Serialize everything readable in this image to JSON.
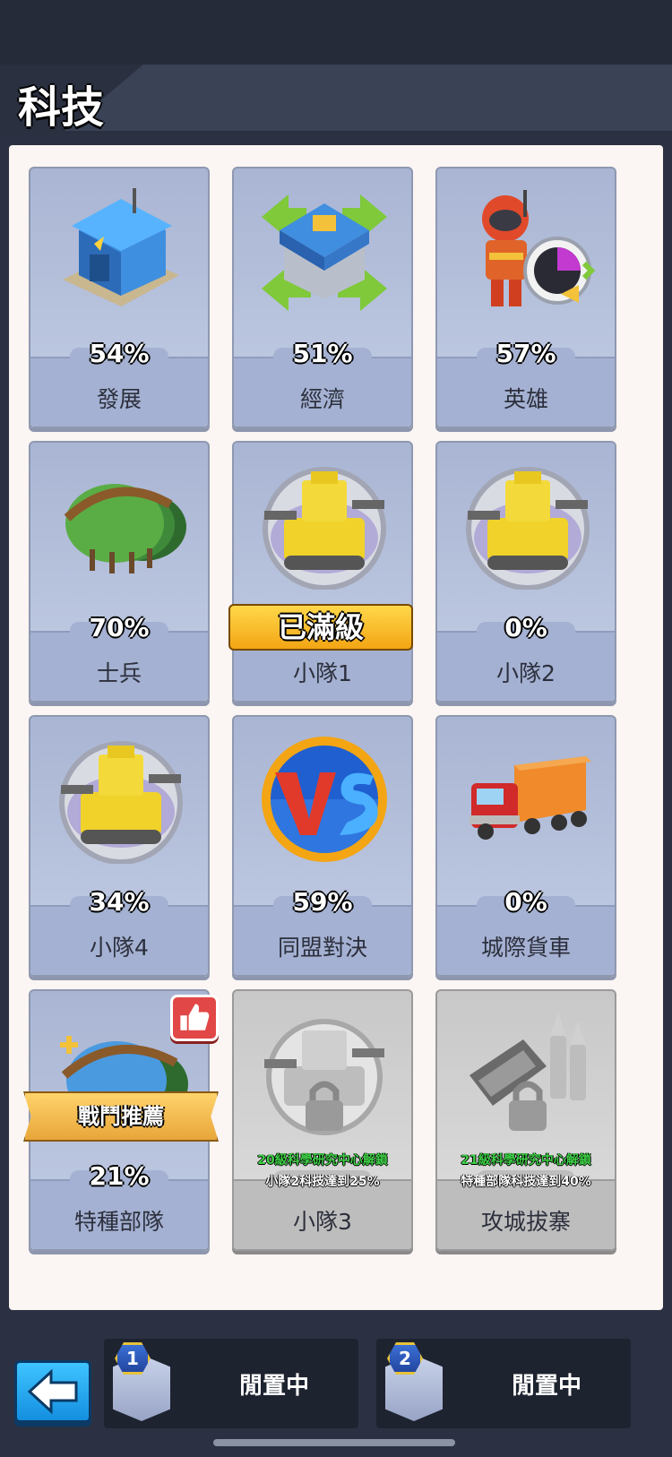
{
  "header": {
    "title": "科技"
  },
  "cards": [
    {
      "name": "發展",
      "percent": "54%",
      "icon": "headquarters-building-icon"
    },
    {
      "name": "經濟",
      "percent": "51%",
      "icon": "economy-building-icon"
    },
    {
      "name": "英雄",
      "percent": "57%",
      "icon": "hero-icon"
    },
    {
      "name": "士兵",
      "percent": "70%",
      "icon": "soldier-helmet-icon"
    },
    {
      "name": "小隊1",
      "badge": "已滿級",
      "icon": "tank-icon"
    },
    {
      "name": "小隊2",
      "percent": "0%",
      "icon": "tank-icon"
    },
    {
      "name": "小隊4",
      "percent": "34%",
      "icon": "tank-icon"
    },
    {
      "name": "同盟對決",
      "percent": "59%",
      "icon": "vs-icon"
    },
    {
      "name": "城際貨車",
      "percent": "0%",
      "icon": "truck-icon"
    },
    {
      "name": "特種部隊",
      "percent": "21%",
      "ribbon": "戰鬥推薦",
      "icon": "special-forces-helmet-icon"
    },
    {
      "name": "小隊3",
      "locked": true,
      "unlock_req": "20級科學研究中心解鎖",
      "unlock_cond": "小隊2科技達到25%",
      "icon": "locked-tank-icon"
    },
    {
      "name": "攻城拔寨",
      "locked": true,
      "unlock_req": "21級科學研究中心解鎖",
      "unlock_cond": "特種部隊科技達到40%",
      "icon": "locked-ammo-icon"
    }
  ],
  "bottom": {
    "slots": [
      {
        "number": "1",
        "status": "閒置中"
      },
      {
        "number": "2",
        "status": "閒置中"
      }
    ]
  },
  "colors": {
    "accent_blue": "#148fe0",
    "maxed_gold": "#f3a514",
    "unlock_green": "#3ecf46"
  }
}
